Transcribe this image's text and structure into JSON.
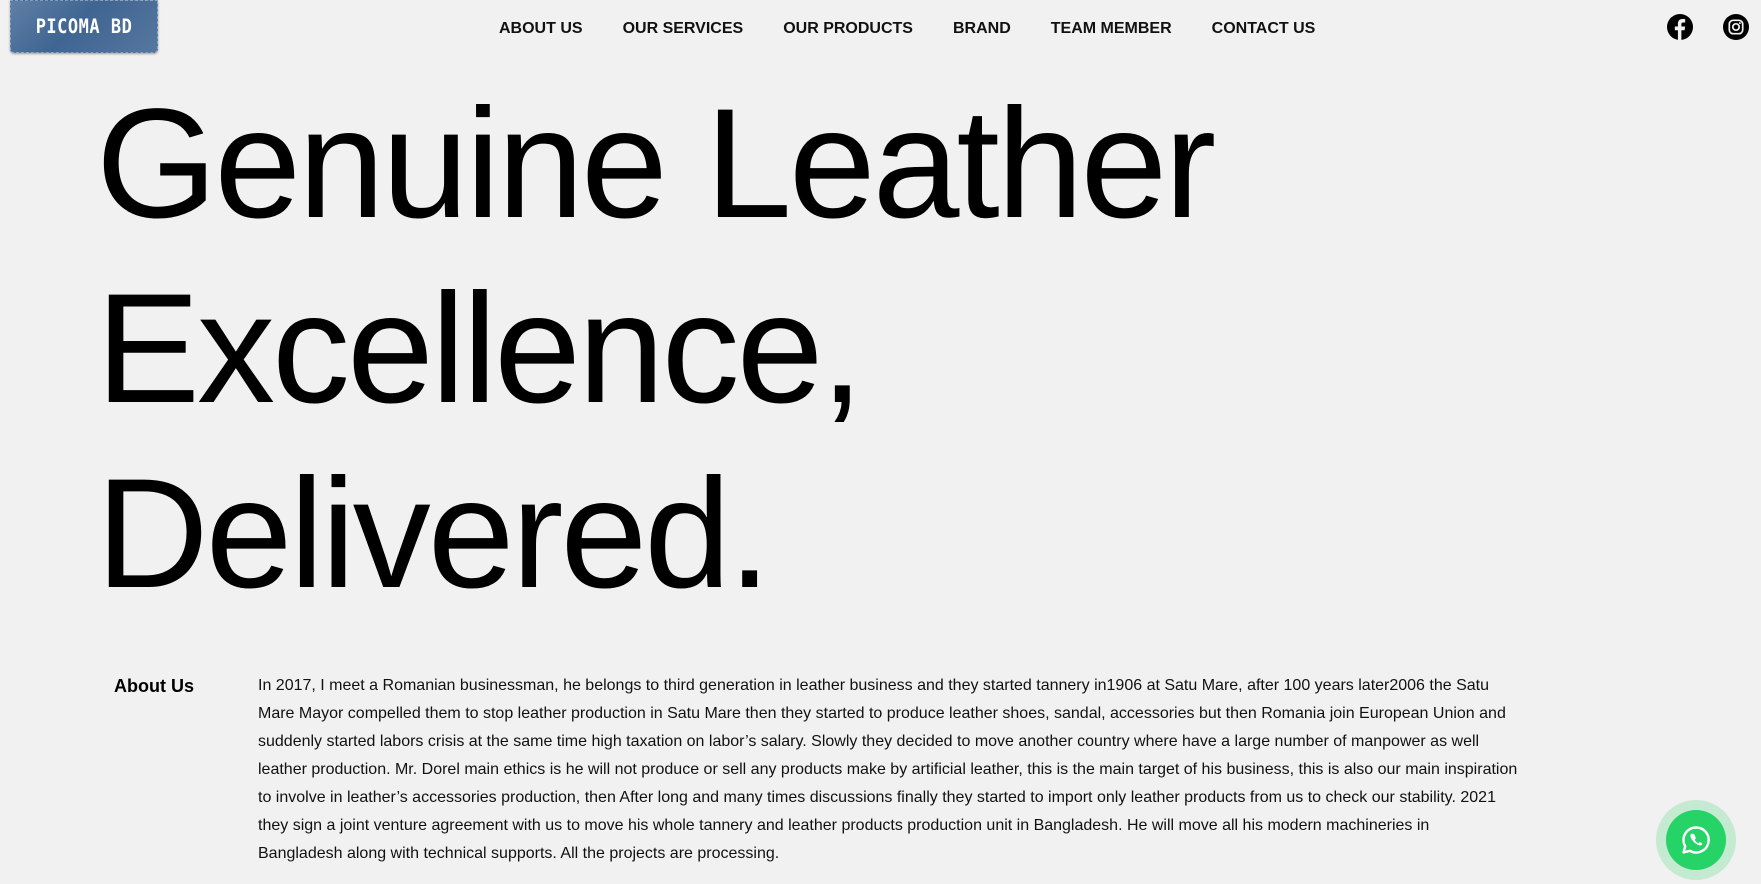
{
  "logo": {
    "text": "PICOMA BD"
  },
  "nav": {
    "items": [
      "ABOUT US",
      "OUR SERVICES",
      "OUR PRODUCTS",
      "BRAND",
      "TEAM MEMBER",
      "CONTACT US"
    ]
  },
  "social": {
    "icons": [
      "facebook-icon",
      "instagram-icon"
    ]
  },
  "hero": {
    "line1": "Genuine Leather",
    "line2": "Excellence,",
    "line3": "Delivered."
  },
  "about": {
    "label": "About Us",
    "text": "In 2017, I meet a Romanian businessman, he belongs to third generation in leather business and they started tannery in1906 at Satu Mare, after 100 years later2006 the Satu Mare Mayor compelled them to stop leather production in Satu Mare then they started to produce leather shoes, sandal, accessories but then Romania join European Union and suddenly started labors crisis at the same time high taxation on labor’s salary. Slowly they decided to move another country where have a large number of manpower as well leather production. Mr. Dorel main ethics is he will not produce or sell any products make by artificial leather, this is the main target of his business, this is also our main inspiration to involve in leather’s accessories production, then After long and many times discussions finally they started to import only leather products from us to check our stability. 2021 they sign a joint venture agreement with us to move his whole tannery and leather products production unit in Bangladesh. He will move all his modern machineries in Bangladesh along with technical supports. All the projects are processing."
  },
  "whatsapp": {
    "icon": "whatsapp-icon"
  },
  "colors": {
    "background": "#f1f1f1",
    "whatsapp": "#25d366",
    "logo_bg": "#4a6d98"
  }
}
